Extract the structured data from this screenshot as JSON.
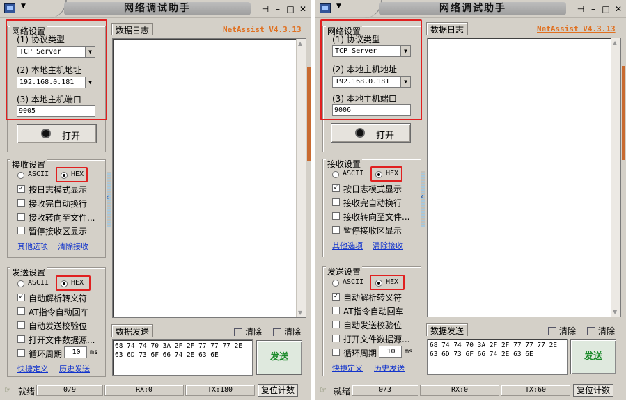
{
  "windows": [
    {
      "title": "网络调试助手",
      "brand": "NetAssist V4.3.13",
      "network": {
        "group_title": "网络设置",
        "protocol_label": "(1) 协议类型",
        "protocol_value": "TCP Server",
        "host_label": "(2) 本地主机地址",
        "host_value": "192.168.0.181",
        "port_label": "(3) 本地主机端口",
        "port_value": "9005",
        "open_button": "打开"
      },
      "receive": {
        "group_title": "接收设置",
        "ascii": "ASCII",
        "hex": "HEX",
        "log_mode": "按日志模式显示",
        "auto_wrap": "接收完自动换行",
        "redirect_file": "接收转向至文件...",
        "pause_display": "暂停接收区显示",
        "other_options": "其他选项",
        "clear_receive": "清除接收"
      },
      "send": {
        "group_title": "发送设置",
        "ascii": "ASCII",
        "hex": "HEX",
        "auto_escape": "自动解析转义符",
        "at_auto_cr": "AT指令自动回车",
        "auto_checksum": "自动发送校验位",
        "open_file_source": "打开文件数据源...",
        "loop_period": "循环周期",
        "loop_value": "10",
        "loop_unit": "ms",
        "shortcut_def": "快捷定义",
        "history_send": "历史发送"
      },
      "log_tab": "数据日志",
      "send_tab": "数据发送",
      "clear1": "清除",
      "clear2": "清除",
      "send_data_line1": "68 74 74 70 3A 2F 2F 77 77 77 2E",
      "send_data_line2": "63 6D 73 6F 66 74 2E 63 6E",
      "send_button": "发送",
      "status": {
        "ready": "就绪",
        "count": "0/9",
        "rx": "RX:0",
        "tx": "TX:180",
        "reset": "复位计数"
      }
    },
    {
      "title": "网络调试助手",
      "brand": "NetAssist V4.3.13",
      "network": {
        "group_title": "网络设置",
        "protocol_label": "(1) 协议类型",
        "protocol_value": "TCP Server",
        "host_label": "(2) 本地主机地址",
        "host_value": "192.168.0.181",
        "port_label": "(3) 本地主机端口",
        "port_value": "9006",
        "open_button": "打开"
      },
      "receive": {
        "group_title": "接收设置",
        "ascii": "ASCII",
        "hex": "HEX",
        "log_mode": "按日志模式显示",
        "auto_wrap": "接收完自动换行",
        "redirect_file": "接收转向至文件...",
        "pause_display": "暂停接收区显示",
        "other_options": "其他选项",
        "clear_receive": "清除接收"
      },
      "send": {
        "group_title": "发送设置",
        "ascii": "ASCII",
        "hex": "HEX",
        "auto_escape": "自动解析转义符",
        "at_auto_cr": "AT指令自动回车",
        "auto_checksum": "自动发送校验位",
        "open_file_source": "打开文件数据源...",
        "loop_period": "循环周期",
        "loop_value": "10",
        "loop_unit": "ms",
        "shortcut_def": "快捷定义",
        "history_send": "历史发送"
      },
      "log_tab": "数据日志",
      "send_tab": "数据发送",
      "clear1": "清除",
      "clear2": "清除",
      "send_data_line1": "68 74 74 70 3A 2F 2F 77 77 77 2E",
      "send_data_line2": "63 6D 73 6F 66 74 2E 63 6E",
      "send_button": "发送",
      "status": {
        "ready": "就绪",
        "count": "0/3",
        "rx": "RX:0",
        "tx": "TX:60",
        "reset": "复位计数"
      }
    }
  ]
}
